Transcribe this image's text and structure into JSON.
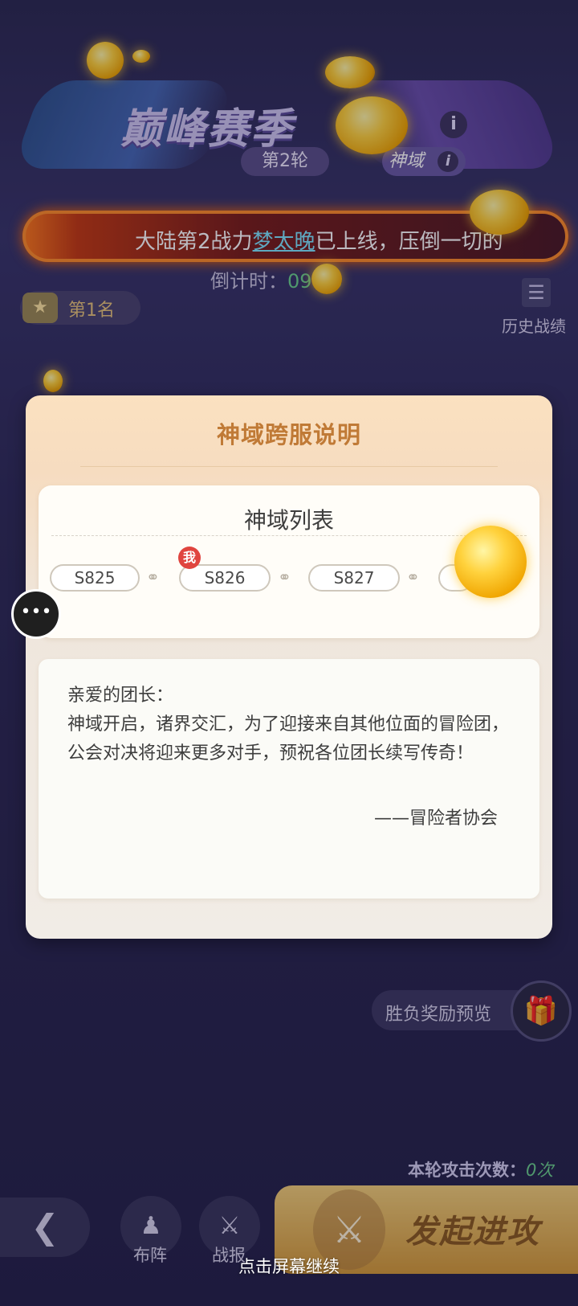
{
  "header": {
    "season_title": "巅峰赛季",
    "info_glyph": "i",
    "round_label": "第2轮",
    "realm_label": "神域"
  },
  "ticker": {
    "prefix": "大陆第2战力",
    "highlight": "梦太晚",
    "suffix": "已上线，压倒一切的",
    "highlight_color": "#7fe6ff"
  },
  "countdown": {
    "label": "倒计时：",
    "value": "09 23"
  },
  "rank": {
    "icon": "trophy-icon",
    "label": "第1名"
  },
  "history": {
    "icon": "list-icon",
    "label": "历史战绩"
  },
  "popup": {
    "title": "神域跨服说明",
    "server_list": {
      "title": "神域列表",
      "me_badge": "我",
      "servers": [
        "S825",
        "S826",
        "S827"
      ]
    },
    "letter": {
      "greeting": "亲爱的团长：",
      "body": "神域开启，诸界交汇，为了迎接来自其他位面的冒险团，公会对决将迎来更多对手，预祝各位团长续写传奇！",
      "signature": "——冒险者协会"
    }
  },
  "rewards": {
    "label": "胜负奖励预览",
    "icon": "gift-icon"
  },
  "attempts": {
    "label": "本轮攻击次数：",
    "value": "0次"
  },
  "bottom_bar": {
    "back_icon": "chevron-left-icon",
    "formation_label": "布阵",
    "report_label": "战报",
    "attack_label": "发起进攻"
  },
  "continue_hint": "点击屏幕继续",
  "colors": {
    "popup_title": "#c07a36",
    "accent_green": "#6bd08c",
    "me_badge": "#e0453f"
  }
}
